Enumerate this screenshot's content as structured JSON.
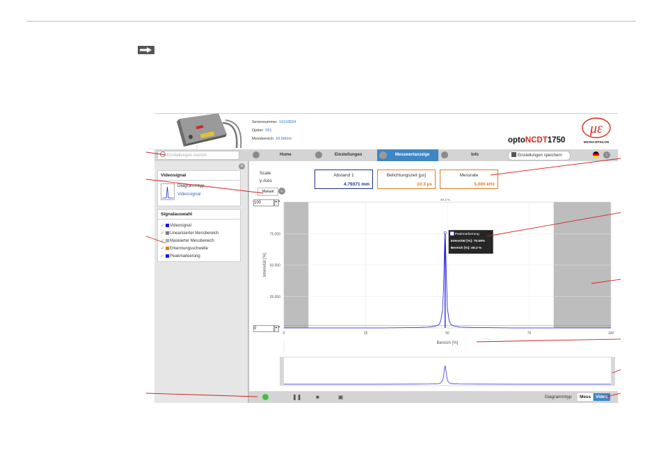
{
  "sensor": {
    "serial_label": "Seriennummer",
    "serial_value": "16110024",
    "option_label": "Option",
    "option_value": "001",
    "range_label": "Messbereich",
    "range_value": "10.00mm",
    "brand_prefix": "opto",
    "brand_red": "NCDT",
    "brand_suffix": "1750",
    "logo_text": "MICRO-EPSILON"
  },
  "nav": {
    "search_placeholder": "Einstellungen suchen",
    "home": "Home",
    "settings": "Einstellungen",
    "measurement": "Messwertanzeige",
    "info": "Info",
    "save": "Einstellungen speichern",
    "icons": [
      "home-icon",
      "settings-icon",
      "measurement-icon",
      "info-icon",
      "save-icon",
      "flag-de-icon",
      "chevron-down-icon"
    ]
  },
  "left_panel": {
    "video_title": "Videosignal",
    "diagram_type_label": "Diagrammtyp",
    "diagram_type_value": "Videosignal",
    "signal_title": "Signalauswahl",
    "signals": [
      {
        "label": "Videosignal",
        "color": "#1a1adc"
      },
      {
        "label": "Linearisierter Messbereich",
        "color": "#7a7a7a"
      },
      {
        "label": "Maskierter Messbereich",
        "color": "#b0b0b0"
      },
      {
        "label": "Erkennungsschwelle",
        "color": "#e57a1e"
      },
      {
        "label": "Peakmarkierung",
        "color": "#1a1adc"
      }
    ]
  },
  "values": {
    "scale_label": "Scale",
    "yaxis_label": "y-Axis",
    "manual_label": "Manual",
    "ymax_value": "100",
    "ymin_value": "0",
    "abstand_label": "Abstand 1",
    "abstand_value": "4.79371 mm",
    "belicht_label": "Belichtungszeit [µs]",
    "belicht_value": "10.3 µs",
    "messrate_label": "Messrate",
    "messrate_value": "5.000 kHz",
    "color_blue": "#1c2c8c",
    "color_orange": "#e07b1a"
  },
  "chart_data": {
    "type": "line",
    "xlabel": "Bereich [%]",
    "ylabel": "Intensität [%]",
    "xlim": [
      0,
      100
    ],
    "ylim": [
      0,
      100
    ],
    "xticks": [
      0,
      25,
      50,
      75,
      100
    ],
    "yticks": [
      25.0,
      50.0,
      75.0
    ],
    "ytick_labels": [
      "25.000",
      "50.000",
      "75.000"
    ],
    "mask_regions": [
      [
        0,
        7.5
      ],
      [
        82.5,
        100
      ]
    ],
    "threshold": 2,
    "peak_marker_label": "49.3 %",
    "series": [
      {
        "x": [
          0,
          10,
          20,
          30,
          40,
          44,
          46,
          47,
          47.5,
          48,
          48.5,
          48.8,
          49,
          49.2,
          49.3,
          49.4,
          49.6,
          49.8,
          50,
          50.5,
          51,
          52,
          54,
          60,
          70,
          80,
          90,
          100
        ],
        "y": [
          0,
          0,
          0,
          0,
          0.3,
          0.6,
          1.2,
          2,
          3,
          6,
          14,
          30,
          52,
          70,
          75.59,
          70,
          52,
          30,
          16,
          6,
          3,
          1.5,
          0.6,
          0.3,
          0,
          0,
          0,
          0
        ]
      }
    ],
    "tooltip": {
      "title": "Peakmarkierung",
      "intensity": "Intensität [%]: 75.59%",
      "range": "Bereich [%]: 49.3 %"
    }
  },
  "toolbar": {
    "diagramtyp_label": "Diagrammtyp",
    "mess_label": "Mess",
    "video_label": "Video"
  }
}
